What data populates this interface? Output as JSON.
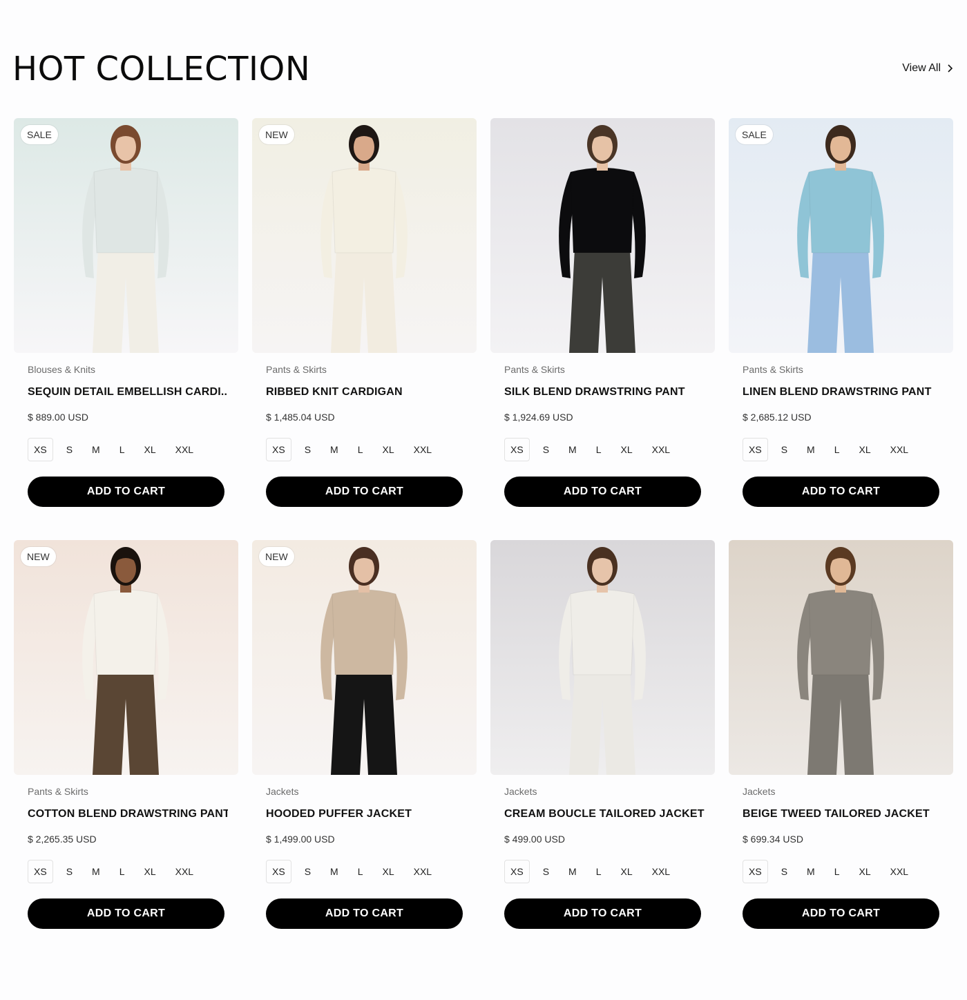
{
  "header": {
    "title": "HOT COLLECTION",
    "view_all": "View All"
  },
  "sizes": [
    "XS",
    "S",
    "M",
    "L",
    "XL",
    "XXL"
  ],
  "cart_label": "ADD TO CART",
  "products": [
    {
      "badge": "SALE",
      "category": "Blouses & Knits",
      "name": "SEQUIN DETAIL EMBELLISH CARDI...",
      "price": "$ 889.00 USD",
      "bg_top": "#dde9e6",
      "bg_bottom": "#f7f6f8",
      "top_color": "#dfe6e4",
      "bottom_color": "#f1eee6",
      "skin": "#e8c3a8",
      "hair": "#7a4a2f"
    },
    {
      "badge": "NEW",
      "category": "Pants & Skirts",
      "name": "RIBBED KNIT CARDIGAN",
      "price": "$ 1,485.04 USD",
      "bg_top": "#f1efe3",
      "bg_bottom": "#f6f4f4",
      "top_color": "#f3efe2",
      "bottom_color": "#f2ece0",
      "skin": "#d9a98a",
      "hair": "#1e1714"
    },
    {
      "badge": "",
      "category": "Pants & Skirts",
      "name": "SILK BLEND DRAWSTRING PANT",
      "price": "$ 1,924.69 USD",
      "bg_top": "#e3e2e6",
      "bg_bottom": "#f3f2f4",
      "top_color": "#0c0c0e",
      "bottom_color": "#3c3c38",
      "skin": "#e6c2a6",
      "hair": "#4a3526"
    },
    {
      "badge": "SALE",
      "category": "Pants & Skirts",
      "name": "LINEN BLEND DRAWSTRING PANT",
      "price": "$ 2,685.12 USD",
      "bg_top": "#e3ebf3",
      "bg_bottom": "#f3f4f8",
      "top_color": "#8fc4d6",
      "bottom_color": "#9bbde0",
      "skin": "#e2b896",
      "hair": "#3d2a1d"
    },
    {
      "badge": "NEW",
      "category": "Pants & Skirts",
      "name": "COTTON BLEND DRAWSTRING PANT",
      "price": "$ 2,265.35 USD",
      "bg_top": "#f1e3da",
      "bg_bottom": "#f7f3f0",
      "top_color": "#f4f1ea",
      "bottom_color": "#5a4634",
      "skin": "#8a5a3c",
      "hair": "#1a120d"
    },
    {
      "badge": "NEW",
      "category": "Jackets",
      "name": "HOODED PUFFER JACKET",
      "price": "$ 1,499.00 USD",
      "bg_top": "#f3ebe2",
      "bg_bottom": "#f7f4f3",
      "top_color": "#cdb8a1",
      "bottom_color": "#151515",
      "skin": "#e4c0a6",
      "hair": "#4a2f22"
    },
    {
      "badge": "",
      "category": "Jackets",
      "name": "CREAM BOUCLE TAILORED JACKET",
      "price": "$ 499.00 USD",
      "bg_top": "#d9d7da",
      "bg_bottom": "#efeeef",
      "top_color": "#efede8",
      "bottom_color": "#ebe9e4",
      "skin": "#e6c4aa",
      "hair": "#4a3121"
    },
    {
      "badge": "",
      "category": "Jackets",
      "name": "BEIGE TWEED TAILORED JACKET",
      "price": "$ 699.34 USD",
      "bg_top": "#ddd4c9",
      "bg_bottom": "#ece8e4",
      "top_color": "#8a857d",
      "bottom_color": "#7d7972",
      "skin": "#e0b896",
      "hair": "#5a3a22"
    }
  ]
}
